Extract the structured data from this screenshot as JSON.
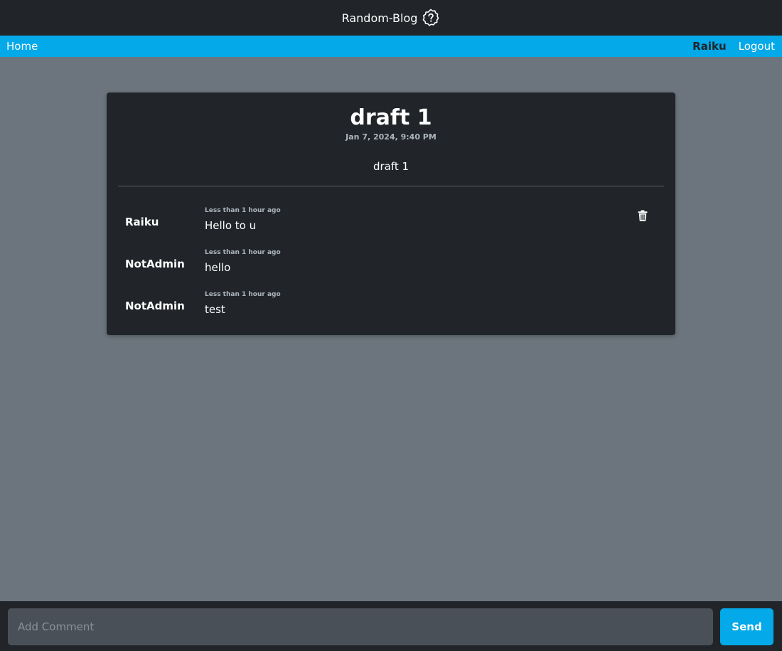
{
  "header": {
    "brand": "Random-Blog",
    "brand_icon": "question-badge-icon"
  },
  "nav": {
    "home": "Home",
    "user": "Raiku",
    "logout": "Logout"
  },
  "post": {
    "title": "draft 1",
    "date": "Jan 7, 2024, 9:40 PM",
    "body": "draft 1"
  },
  "comments": [
    {
      "author": "Raiku",
      "time": "Less than 1 hour ago",
      "text": "Hello to u",
      "deletable": true
    },
    {
      "author": "NotAdmin",
      "time": "Less than 1 hour ago",
      "text": "hello",
      "deletable": false
    },
    {
      "author": "NotAdmin",
      "time": "Less than 1 hour ago",
      "text": "test",
      "deletable": false
    }
  ],
  "composer": {
    "placeholder": "Add Comment",
    "value": "",
    "send_label": "Send"
  },
  "colors": {
    "header_bg": "#212529",
    "nav_bg": "#03a9e8",
    "page_bg": "#6c757d",
    "card_bg": "#212529",
    "input_bg": "#495057"
  }
}
